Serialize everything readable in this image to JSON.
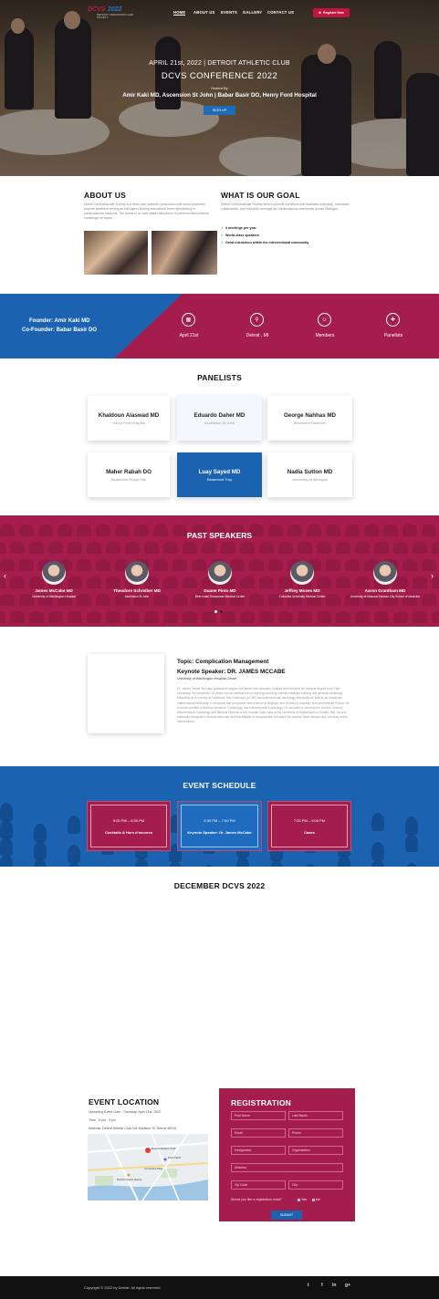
{
  "nav": {
    "logo_main_a": "DCVS",
    "logo_main_b": "2022",
    "logo_sub": "DETROIT CARDIOVASCULAR SOCIETY",
    "items": [
      "HOME",
      "ABOUT US",
      "EVENTS",
      "GALLERY",
      "CONTACT US"
    ],
    "register_label": "Register Now",
    "register_icon": "user-plus-icon"
  },
  "hero": {
    "date_line": "APRIL 21st, 2022 | DETROIT ATHLETIC CLUB",
    "title": "DCVS CONFERENCE 2022",
    "hosted_by": "Hosted By",
    "hosts": "Amir Kaki MD, Ascension St John | Babar Basir DO, Henry Ford Hospital",
    "signup": "SIGN UP"
  },
  "about": {
    "title": "ABOUT US",
    "text": "Detroit Cardiovascular Society is a three-hour scientific symposium with world-renowned keynote speakers serving as Michigan's leading educational forum specializing in cardiovascular medicine. The theme is an case-based discussion of pertinent interventional cardiology hot topics."
  },
  "goal": {
    "title": "WHAT IS OUR GOAL",
    "text": "Detroit Cardiovascular Society aims to provide a platform that facilitates fellowship, innovation, collaboration, and education amongst the cardiovascular community across Michigan.",
    "items": [
      "3 meetings per year",
      "World-class speakers",
      "Great interaction within the interventional community"
    ]
  },
  "band": {
    "founder": "Founder: Amir Kaki MD",
    "cofounder": "Co-Founder: Babar Basir DO",
    "stats": [
      {
        "icon": "calendar-icon",
        "label": "April 21st"
      },
      {
        "icon": "location-pin-icon",
        "label": "Detroit , MI"
      },
      {
        "icon": "members-icon",
        "label": "Members"
      },
      {
        "icon": "panelists-icon",
        "label": "Panelists"
      }
    ]
  },
  "panelists": {
    "title": "PANELISTS",
    "list": [
      {
        "name": "Khaldoun Alaswad MD",
        "aff": "Henry Ford Hospital"
      },
      {
        "name": "Eduardo Daher MD",
        "aff": "Ascension St John"
      },
      {
        "name": "George Nahhas MD",
        "aff": "Beaumont Dearborn"
      },
      {
        "name": "Maher Rabah DO",
        "aff": "Beaumont Royal Oak"
      },
      {
        "name": "Luay Sayed MD",
        "aff": "Beaumont Troy"
      },
      {
        "name": "Nadia Sutton MD",
        "aff": "University of Michigan"
      }
    ]
  },
  "speakers": {
    "title": "PAST SPEAKERS",
    "list": [
      {
        "name": "James McCabe MD",
        "aff": "University of Washington Hospital"
      },
      {
        "name": "Theodore Schreiber MD",
        "aff": "Ascension St John"
      },
      {
        "name": "Duane Pinto MD",
        "aff": "Beth Israel Deaconess Medical Center"
      },
      {
        "name": "Jeffrey Moses MD",
        "aff": "Columbia University Medical Center"
      },
      {
        "name": "Aaron Grantham MD",
        "aff": "University of Missouri-Kansas City School of Medicine"
      }
    ]
  },
  "keynote": {
    "topic": "Topic: Complication Management",
    "speaker": "Keynote Speaker: DR. JAMES MCCABE",
    "aff": "University of Washington Hospital Center",
    "bio": "Dr. James 'Jamie' McCabe graduated magna cum laude from Bowdoin College and received his medical degree from Yale University. He completed 10 years of post-medical school training including internal medicine training and general cardiology fellowship at University of California, San Francisco (UCSF) and interventional cardiology fellowship as well as an advanced interventional fellowship in structural and peripheral interventions at Brigham and Women's Hospital / Harvard Medical School. He is board certified in Internal Medicine, Cardiology, and Interventional Cardiology. Dr. McCabe is currently the Section Chief of Interventional Cardiology and Medical Director of the Cardiac Cath Labs at the University of Washington in Seattle, WA. He is a nationally recognized clinician-educator and investigator in transcatheter therapies for valvular heart disease and coronary artery interventions."
  },
  "schedule": {
    "title": "EVENT SCHEDULE",
    "items": [
      {
        "time": "5:00 PM – 6:30 PM",
        "event": "Cocktails & Hors d'oeuvres"
      },
      {
        "time": "6:30 PM – 7:00 PM",
        "event": "Keynote Speaker: Dr. James McCabe"
      },
      {
        "time": "7:00 PM – 9:00 PM",
        "event": "Cases"
      }
    ]
  },
  "december": {
    "title": "DECEMBER DCVS 2022"
  },
  "location": {
    "title": "EVENT LOCATION",
    "upcoming": "Upcoming Event Date : Thursday, April 21st, 2022",
    "time": "Time : 6 pm - 9 pm",
    "address": "Address: Detroit Athletic Club 241 Madison St, Detroit 48226",
    "map_labels": [
      "Detroit Athletic Club",
      "Detroit Opera House",
      "Ford Field",
      "Comerica Park"
    ]
  },
  "registration": {
    "title": "REGISTRATION",
    "fields": [
      "First Name",
      "Last Name",
      "Email",
      "Phone",
      "Designation",
      "Organization",
      "Address",
      "Zip Code",
      "City"
    ],
    "question": "Would you like a registration meal?",
    "yes": "Yes",
    "no": "No",
    "submit": "SUBMIT"
  },
  "footer": {
    "copyright": "Copyright © 2022 by Detroit. All rights reserved.",
    "social": [
      {
        "icon": "twitter-icon",
        "glyph": "t"
      },
      {
        "icon": "facebook-icon",
        "glyph": "f"
      },
      {
        "icon": "linkedin-icon",
        "glyph": "in"
      },
      {
        "icon": "google-plus-icon",
        "glyph": "g+"
      }
    ]
  },
  "colors": {
    "crimson": "#a51d4d",
    "blue": "#1b63b1",
    "dark": "#111111"
  }
}
